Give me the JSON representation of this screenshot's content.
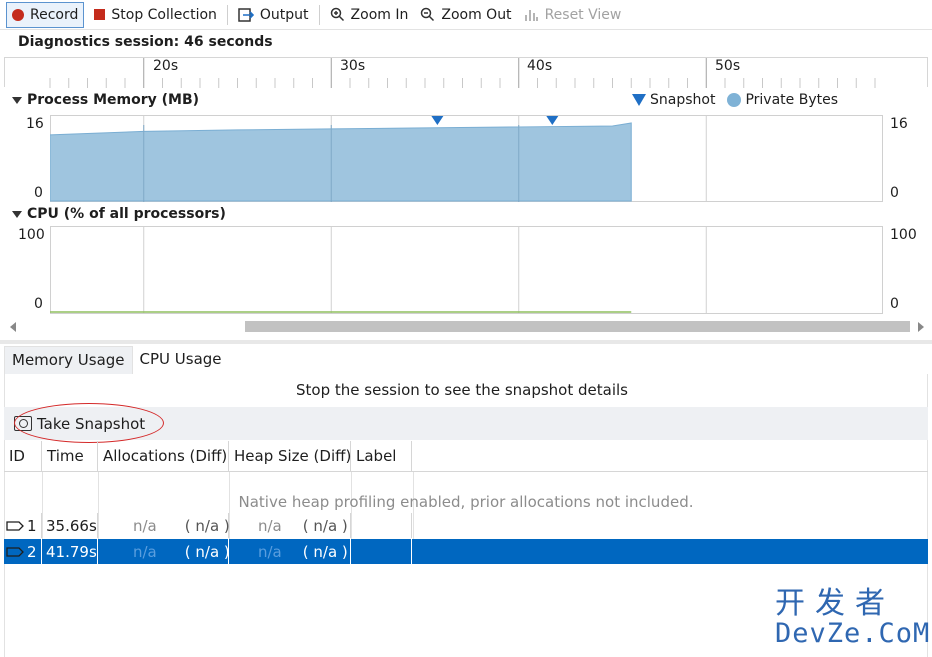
{
  "toolbar": {
    "record": "Record",
    "stop_collection": "Stop Collection",
    "output": "Output",
    "zoom_in": "Zoom In",
    "zoom_out": "Zoom Out",
    "reset_view": "Reset View"
  },
  "session": {
    "label": "Diagnostics session: 46 seconds"
  },
  "timeline": {
    "ticks": [
      "20s",
      "30s",
      "40s",
      "50s"
    ]
  },
  "memory_chart": {
    "title": "Process Memory (MB)",
    "y_max": "16",
    "y_min": "0",
    "legend_snapshot": "Snapshot",
    "legend_private": "Private Bytes",
    "color_area": "#9fc5df",
    "color_snapshot": "#1f6fc5"
  },
  "cpu_chart": {
    "title": "CPU (% of all processors)",
    "y_max": "100",
    "y_min": "0",
    "color_line": "#8fbf5f"
  },
  "chart_data": [
    {
      "type": "area",
      "title": "Process Memory (MB)",
      "xlabel": "",
      "ylabel": "",
      "ylim": [
        0,
        16
      ],
      "x": [
        15,
        20,
        25,
        30,
        35,
        40,
        45,
        46
      ],
      "series": [
        {
          "name": "Private Bytes",
          "values": [
            13.4,
            14.1,
            14.4,
            14.6,
            14.8,
            15.0,
            15.2,
            15.8
          ]
        }
      ],
      "snapshots": [
        35.66,
        41.79
      ]
    },
    {
      "type": "line",
      "title": "CPU (% of all processors)",
      "xlabel": "",
      "ylabel": "",
      "ylim": [
        0,
        100
      ],
      "x": [
        15,
        46
      ],
      "series": [
        {
          "name": "",
          "values": [
            0,
            0
          ]
        }
      ]
    }
  ],
  "tabs": [
    "Memory Usage",
    "CPU Usage"
  ],
  "panel": {
    "stop_message": "Stop the session to see the snapshot details",
    "take_snapshot": "Take Snapshot",
    "note": "Native heap profiling enabled, prior allocations not included."
  },
  "table": {
    "headers": [
      "ID",
      "Time",
      "Allocations (Diff)",
      "Heap Size (Diff)",
      "Label"
    ],
    "rows": [
      {
        "id": "1",
        "time": "35.66s",
        "alloc": "n/a",
        "alloc_diff": "( n/a )",
        "heap": "n/a",
        "heap_diff": "( n/a )",
        "label": ""
      },
      {
        "id": "2",
        "time": "41.79s",
        "alloc": "n/a",
        "alloc_diff": "( n/a )",
        "heap": "n/a",
        "heap_diff": "( n/a )",
        "label": ""
      }
    ]
  },
  "watermark": {
    "line1": "开发者",
    "line2": "DevZe.CoM"
  }
}
